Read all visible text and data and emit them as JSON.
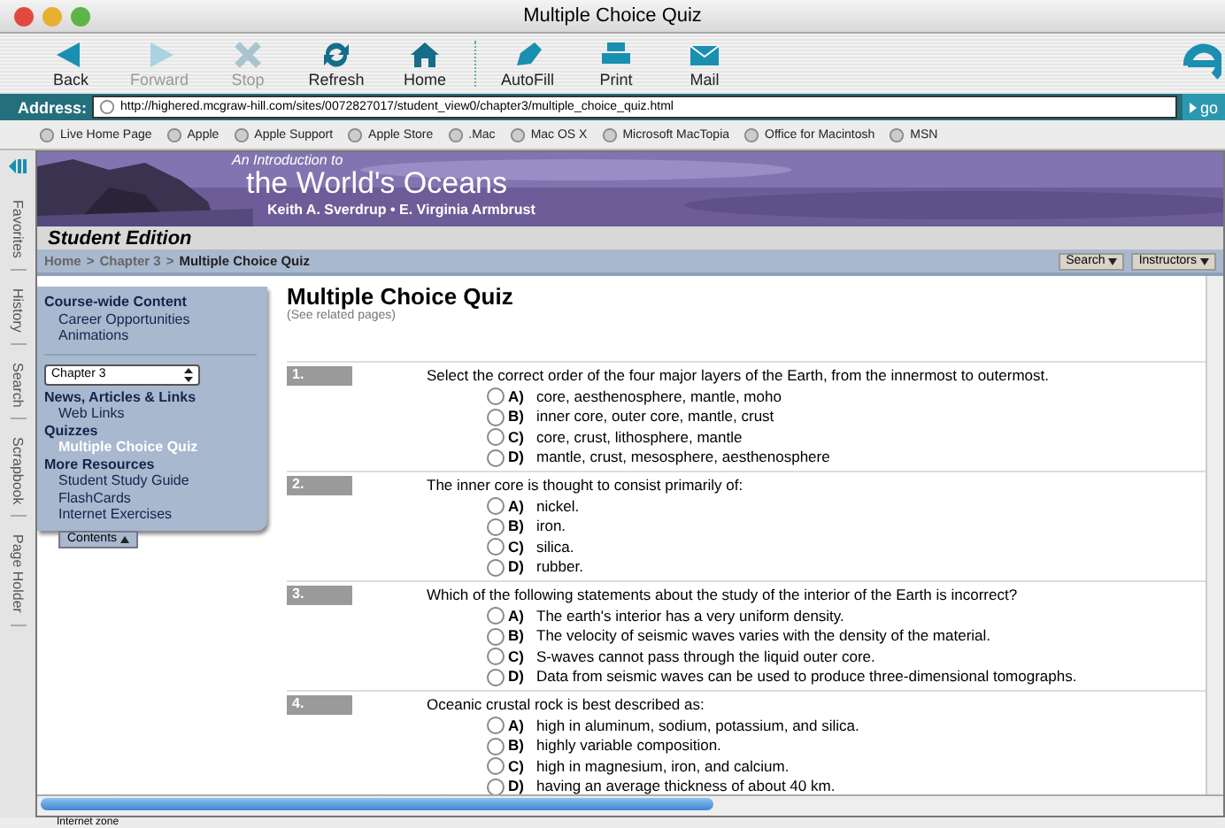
{
  "window": {
    "title": "Multiple Choice Quiz"
  },
  "toolbar": [
    {
      "label": "Back",
      "kind": "back",
      "disabled": false
    },
    {
      "label": "Forward",
      "kind": "forward",
      "disabled": true
    },
    {
      "label": "Stop",
      "kind": "stop",
      "disabled": true
    },
    {
      "label": "Refresh",
      "kind": "refresh",
      "disabled": false
    },
    {
      "label": "Home",
      "kind": "home",
      "disabled": false
    },
    {
      "label": "AutoFill",
      "kind": "autofill",
      "disabled": false
    },
    {
      "label": "Print",
      "kind": "print",
      "disabled": false
    },
    {
      "label": "Mail",
      "kind": "mail",
      "disabled": false
    }
  ],
  "address": {
    "label": "Address:",
    "value": "http://highered.mcgraw-hill.com/sites/0072827017/student_view0/chapter3/multiple_choice_quiz.html",
    "go": "go"
  },
  "favorites": [
    "Live Home Page",
    "Apple",
    "Apple Support",
    "Apple Store",
    ".Mac",
    "Mac OS X",
    "Microsoft MacTopia",
    "Office for Macintosh",
    "MSN"
  ],
  "side_tabs": [
    "Favorites",
    "History",
    "Search",
    "Scrapbook",
    "Page Holder"
  ],
  "banner": {
    "intro": "An Introduction to",
    "title": "the World's Oceans",
    "authors": "Keith A. Sverdrup • E. Virginia Armbrust"
  },
  "edition": "Student Edition",
  "breadcrumb": {
    "links": [
      "Home",
      "Chapter 3"
    ],
    "current": "Multiple Choice Quiz",
    "separator": ">"
  },
  "menus": [
    "Search",
    "Instructors"
  ],
  "sidebar": {
    "sections": [
      {
        "heading": "Course-wide Content",
        "items": [
          {
            "label": "Career Opportunities",
            "selected": false
          },
          {
            "label": "Animations",
            "selected": false
          }
        ]
      }
    ],
    "chapter_select": "Chapter 3",
    "chapter_sections": [
      {
        "heading": "News, Articles & Links",
        "items": [
          {
            "label": "Web Links",
            "selected": false
          }
        ]
      },
      {
        "heading": "Quizzes",
        "items": [
          {
            "label": "Multiple Choice Quiz",
            "selected": true
          }
        ]
      },
      {
        "heading": "More Resources",
        "items": [
          {
            "label": "Student Study Guide",
            "selected": false
          },
          {
            "label": "FlashCards",
            "selected": false
          },
          {
            "label": "Internet Exercises",
            "selected": false
          }
        ]
      }
    ],
    "contents_button": "Contents"
  },
  "page": {
    "title": "Multiple Choice Quiz",
    "subtitle": "(See related pages)"
  },
  "questions": [
    {
      "number": "1.",
      "text": "Select the correct order of the four major layers of the Earth, from the innermost to outermost.",
      "options": [
        {
          "letter": "A)",
          "text": "core, aesthenosphere, mantle, moho",
          "selected": false
        },
        {
          "letter": "B)",
          "text": "inner core, outer core, mantle, crust",
          "selected": false
        },
        {
          "letter": "C)",
          "text": "core, crust, lithosphere, mantle",
          "selected": false
        },
        {
          "letter": "D)",
          "text": "mantle, crust, mesosphere, aesthenosphere",
          "selected": false
        }
      ]
    },
    {
      "number": "2.",
      "text": "The inner core is thought to consist primarily of:",
      "options": [
        {
          "letter": "A)",
          "text": "nickel.",
          "selected": false
        },
        {
          "letter": "B)",
          "text": "iron.",
          "selected": false
        },
        {
          "letter": "C)",
          "text": "silica.",
          "selected": false
        },
        {
          "letter": "D)",
          "text": "rubber.",
          "selected": false
        }
      ]
    },
    {
      "number": "3.",
      "text": "Which of the following statements about the study of the interior of the Earth is incorrect?",
      "options": [
        {
          "letter": "A)",
          "text": "The earth's interior has a very uniform density.",
          "selected": false
        },
        {
          "letter": "B)",
          "text": "The velocity of seismic waves varies with the density of the material.",
          "selected": false
        },
        {
          "letter": "C)",
          "text": "S-waves cannot pass through the liquid outer core.",
          "selected": false
        },
        {
          "letter": "D)",
          "text": "Data from seismic waves can be used to produce three-dimensional tomographs.",
          "selected": false
        }
      ]
    },
    {
      "number": "4.",
      "text": "Oceanic crustal rock is best described as:",
      "options": [
        {
          "letter": "A)",
          "text": "high in aluminum, sodium, potassium, and silica.",
          "selected": false
        },
        {
          "letter": "B)",
          "text": "highly variable composition.",
          "selected": false
        },
        {
          "letter": "C)",
          "text": "high in magnesium, iron, and calcium.",
          "selected": false
        },
        {
          "letter": "D)",
          "text": "having an average thickness of about 40 km.",
          "selected": false
        }
      ]
    }
  ],
  "status_bar": "Internet zone"
}
